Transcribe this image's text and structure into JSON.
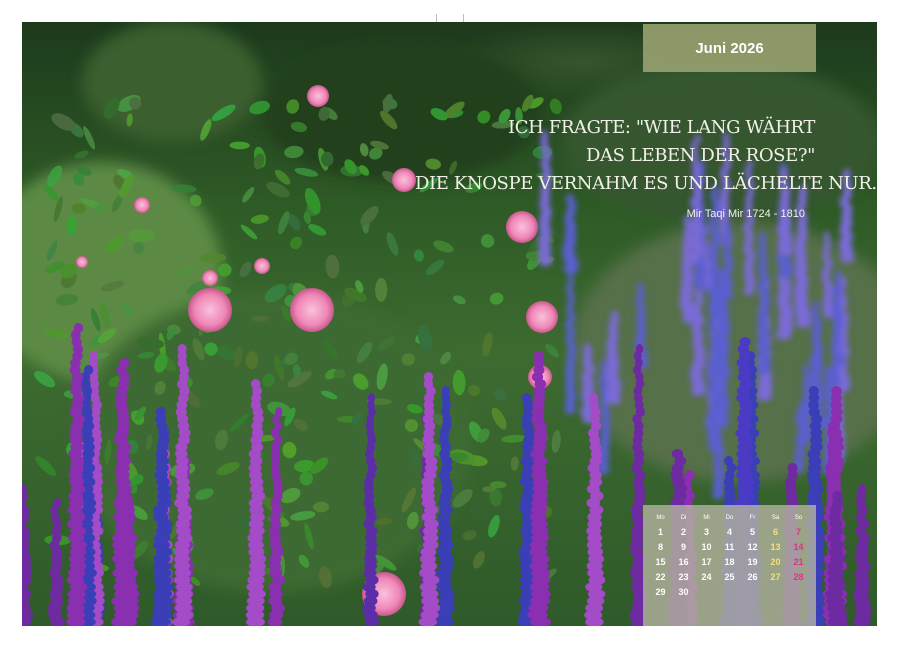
{
  "calendar": {
    "month_title": "Juni 2026",
    "weekdays": [
      "Mo",
      "Di",
      "Mi",
      "Do",
      "Fr",
      "Sa",
      "So"
    ],
    "weeks": [
      [
        "1",
        "2",
        "3",
        "4",
        "5",
        "6",
        "7"
      ],
      [
        "8",
        "9",
        "10",
        "11",
        "12",
        "13",
        "14"
      ],
      [
        "15",
        "16",
        "17",
        "18",
        "19",
        "20",
        "21"
      ],
      [
        "22",
        "23",
        "24",
        "25",
        "26",
        "27",
        "28"
      ],
      [
        "29",
        "30",
        "",
        "",
        "",
        "",
        ""
      ]
    ]
  },
  "quote": {
    "lines": [
      "ICH FRAGTE: \"WIE LANG WÄHRT",
      "DAS LEBEN DER ROSE?\"",
      "DIE KNOSPE VERNAHM ES UND LÄCHELTE NUR."
    ],
    "author": "Mir Taqi Mir 1724 - 1810"
  },
  "colors": {
    "saturday": "#f0e27a",
    "sunday": "#e0308a",
    "month_box": "#96a06e"
  },
  "photo": {
    "subject": "pink roses and purple lavender flowers"
  }
}
